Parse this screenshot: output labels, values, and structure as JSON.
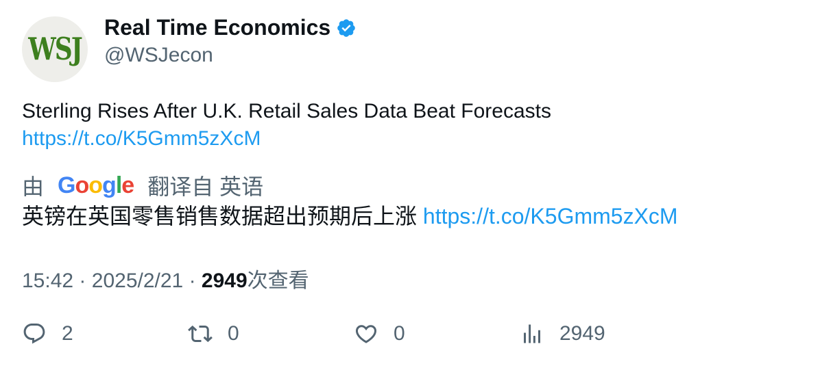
{
  "author": {
    "avatar_text": "WSJ",
    "name": "Real Time Economics",
    "handle": "@WSJecon",
    "verified_icon": "verified-badge-icon"
  },
  "tweet": {
    "text": "Sterling Rises After U.K. Retail Sales Data Beat Forecasts",
    "link": "https://t.co/K5Gmm5zXcM"
  },
  "translation": {
    "prefix": "由",
    "provider_letters": [
      "G",
      "o",
      "o",
      "g",
      "l",
      "e"
    ],
    "suffix": "翻译自 英语",
    "text": "英镑在英国零售销售数据超出预期后上涨",
    "link": "https://t.co/K5Gmm5zXcM"
  },
  "meta": {
    "time": "15:42",
    "sep": "·",
    "date": "2025/2/21",
    "views": "2949",
    "views_label": "次查看"
  },
  "actions": {
    "reply": "2",
    "retweet": "0",
    "like": "0",
    "views": "2949"
  },
  "colors": {
    "link": "#1d9bf0",
    "muted": "#536471",
    "text": "#0f1419"
  }
}
